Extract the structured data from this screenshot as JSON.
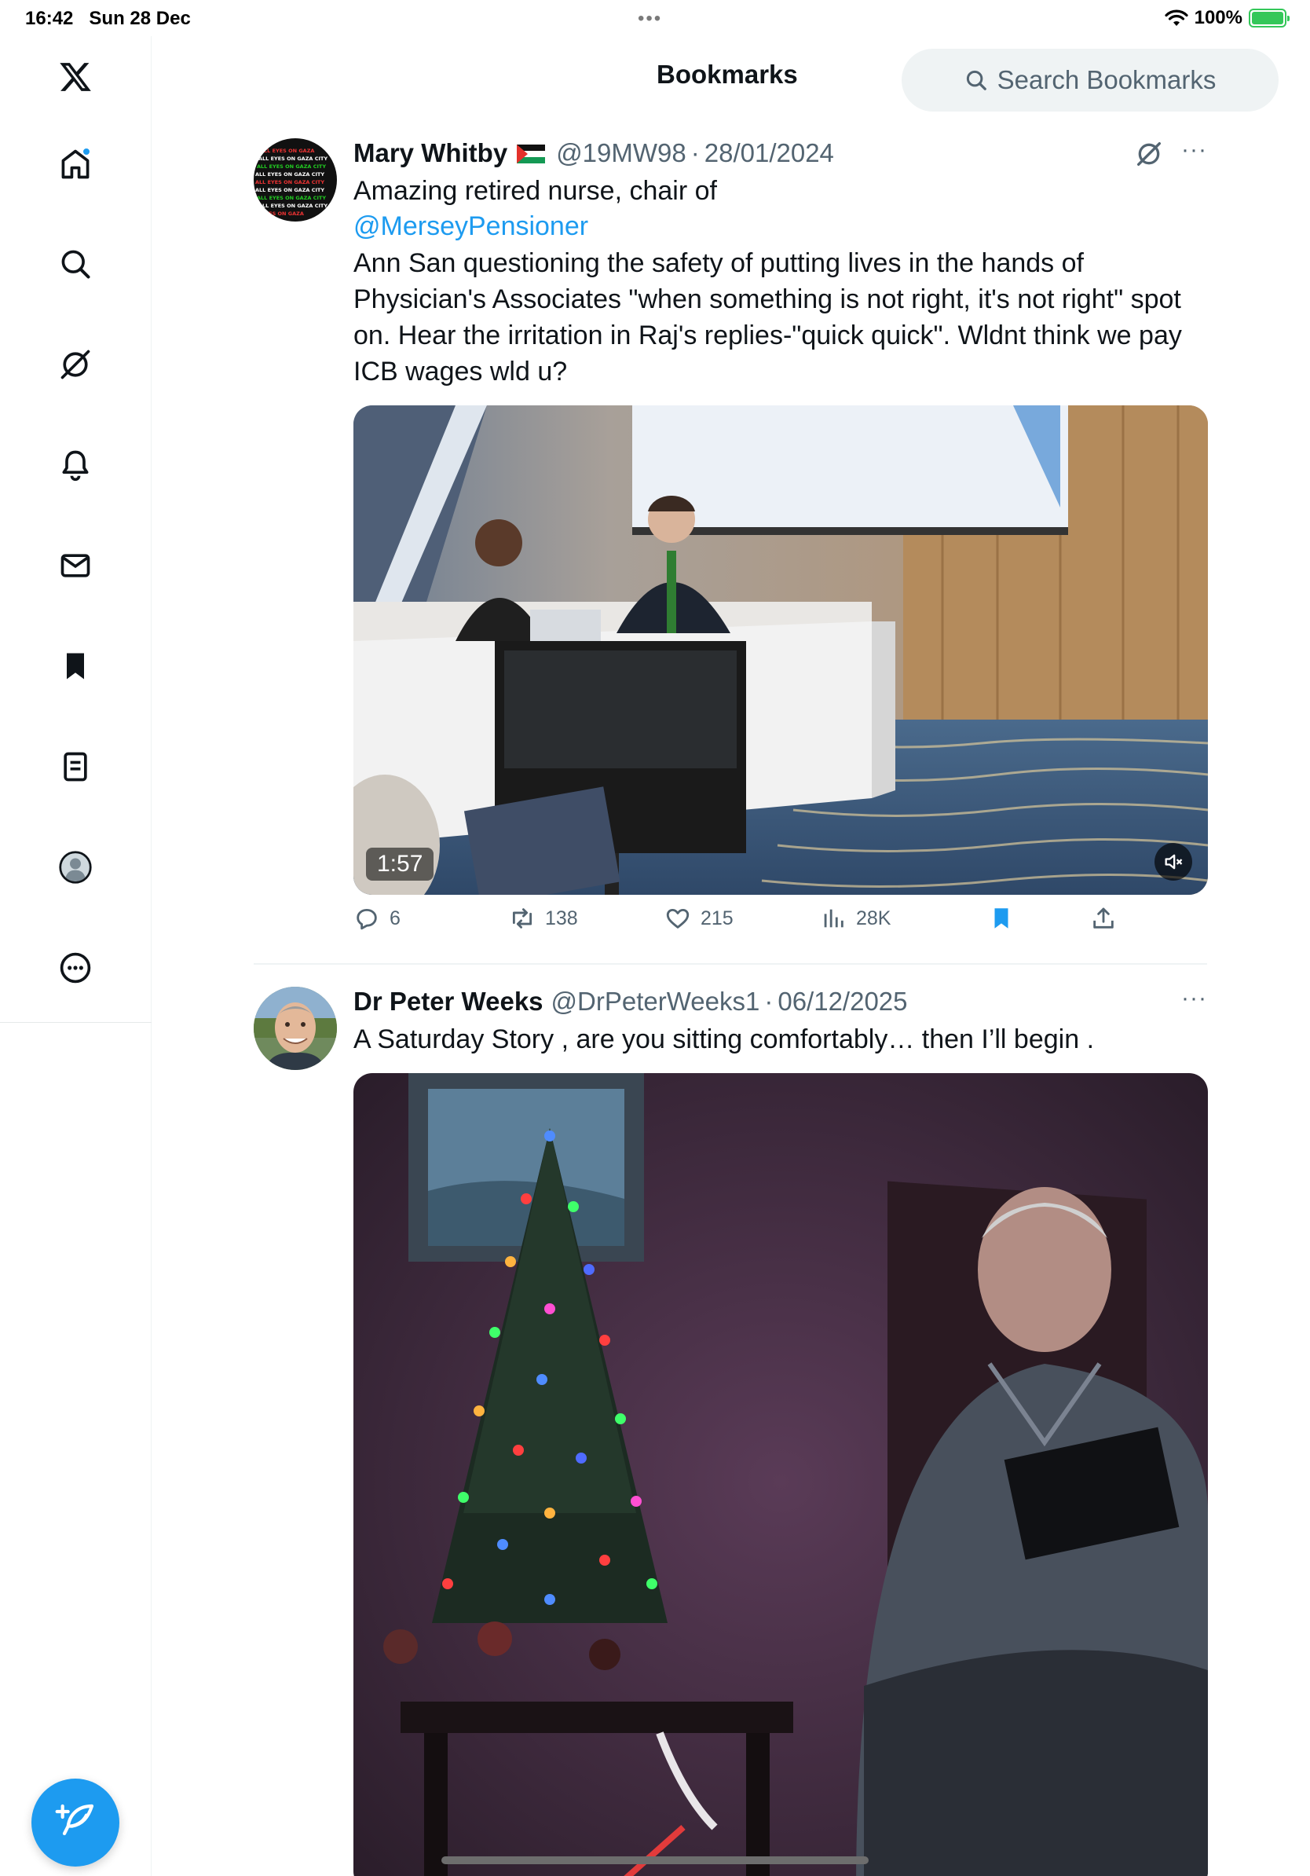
{
  "status_bar": {
    "time": "16:42",
    "date": "Sun 28 Dec",
    "multitask_dots": "•••",
    "battery_percent": "100%",
    "battery_level": 1.0
  },
  "sidebar": {
    "items": [
      {
        "icon": "x-logo-icon"
      },
      {
        "icon": "home-icon",
        "has_notification_dot": true
      },
      {
        "icon": "search-icon"
      },
      {
        "icon": "grok-icon"
      },
      {
        "icon": "bell-icon"
      },
      {
        "icon": "mail-icon"
      },
      {
        "icon": "bookmark-icon"
      },
      {
        "icon": "lists-icon"
      },
      {
        "icon": "profile-icon"
      },
      {
        "icon": "more-icon"
      }
    ],
    "compose_icon": "compose-icon"
  },
  "header": {
    "title": "Bookmarks",
    "search_placeholder": "Search Bookmarks"
  },
  "tweets": [
    {
      "name": "Mary Whitby",
      "flag": "palestine-flag",
      "handle": "@19MW98",
      "separator": "·",
      "date": "28/01/2024",
      "text_line1": "Amazing retired nurse, chair of",
      "mention": "@MerseyPensioner",
      "text_body": " Ann San questioning the safety of putting lives in the hands of Physician's Associates \"when something is not right, it's not right\" spot on. Hear the irritation in Raj's replies-\"quick quick\". Wldnt think we pay ICB wages wld u?",
      "video_duration": "1:57",
      "stats": {
        "replies": "6",
        "reposts": "138",
        "likes": "215",
        "views": "28K"
      },
      "bookmarked": true,
      "more": "···"
    },
    {
      "name": "Dr Peter Weeks",
      "handle": "@DrPeterWeeks1",
      "separator": "·",
      "date": "06/12/2025",
      "text": "A Saturday Story , are you sitting comfortably… then I’ll begin .",
      "more": "···"
    }
  ],
  "colors": {
    "accent": "#1d9bf0",
    "text_primary": "#0f1419",
    "text_secondary": "#536471",
    "search_bg": "#eff3f4"
  }
}
